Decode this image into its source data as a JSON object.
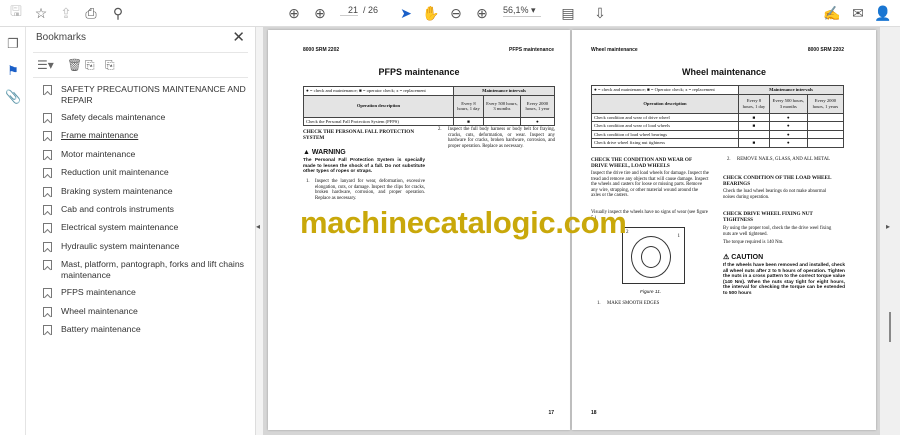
{
  "toolbar": {
    "page_current": "21",
    "page_total": "/ 26",
    "zoom": "56,1%",
    "zoom_caret": "▾"
  },
  "bookmarks": {
    "title": "Bookmarks",
    "close": "✕",
    "items": [
      "SAFETY PRECAUTIONS MAINTENANCE AND REPAIR",
      "Safety decals maintenance",
      "Frame maintenance",
      "Motor maintenance",
      "Reduction unit maintenance",
      "Braking system maintenance",
      "Cab and controls instruments",
      "Electrical system maintenance",
      "Hydraulic system maintenance",
      "Mast, platform, pantograph, forks and lift chains maintenance",
      "PFPS maintenance",
      "Wheel maintenance",
      "Battery maintenance"
    ]
  },
  "left_page": {
    "hdr_left": "8000 SRM 2202",
    "hdr_right": "PFPS maintenance",
    "title": "PFPS maintenance",
    "legend": "● = check and maintenance; ■ = operator check; x = replacement",
    "intervals": "Maintenance intervals",
    "op_desc": "Operation description",
    "cols": [
      "Every 8 hours, 1 day",
      "Every 500 hours, 3 months",
      "Every 2000 hours, 1 year"
    ],
    "rows": [
      {
        "desc": "Check the Personal Fall Protection System (PFPS)",
        "c1": "■",
        "c2": "",
        "c3": "●"
      }
    ],
    "section": "CHECK THE PERSONAL FALL PROTECTION SYSTEM",
    "warning": "WARNING",
    "warning_text": "The Personal Fall Protection System is specially made to lessen the shock of a fall. Do not substitute other types of ropes or straps.",
    "step1_num": "1.",
    "step1": "Inspect the lanyard for wear, deformation, excessive elongation, cuts, or damage. Inspect the clips for cracks, broken hardware, corrosion, and proper operation. Replace as necessary.",
    "step2_num": "2.",
    "step2": "Inspect the full body harness or body belt for fraying, cracks, cuts, deformation, or wear. Inspect any hardware for cracks, broken hardware, corrosion, and proper operation. Replace as necessary.",
    "page_num": "17"
  },
  "right_page": {
    "hdr_left": "Wheel maintenance",
    "hdr_right": "8000 SRM 2202",
    "title": "Wheel maintenance",
    "legend": "● = check and maintenance; ■ = Operator check; x = replacement",
    "intervals": "Maintenance intervals",
    "op_desc": "Operation description",
    "cols": [
      "Every 8 hours, 1 day",
      "Every 500 hours, 3 months",
      "Every 2000 hours, 1 years"
    ],
    "rows": [
      {
        "desc": "Check condition and wear of drive wheel",
        "c1": "■",
        "c2": "●",
        "c3": ""
      },
      {
        "desc": "Check condition and wear of load wheels",
        "c1": "■",
        "c2": "●",
        "c3": ""
      },
      {
        "desc": "Check condition of load wheel bearings",
        "c1": "",
        "c2": "●",
        "c3": ""
      },
      {
        "desc": "Check drive wheel fixing nut tightness",
        "c1": "■",
        "c2": "●",
        "c3": ""
      }
    ],
    "s1": "CHECK THE CONDITION AND WEAR OF DRIVE WHEEL, LOAD WHEELS",
    "p1": "Inspect the drive tire and load wheels for damage. Inspect the tread and remove any objects that will cause damage. Inspect the wheels and casters for loose or missing parts. Remove any wire, strapping, or other material wound around the axles or the casters.",
    "p2": "Visually inspect the wheels have no signs of wear (see figure 5.)",
    "figure": "Figure 11.",
    "callout1": "1",
    "callout2": "2",
    "step1_num": "1.",
    "step1": "MAKE SMOOTH EDGES",
    "step2_num": "2.",
    "step2": "REMOVE NAILS, GLASS, AND ALL METAL",
    "s2": "CHECK CONDITION OF THE LOAD WHEEL BEARINGS",
    "p3": "Check the load wheel bearings do not make abnormal noises during operation.",
    "s3": "CHECK DRIVE WHEEL FIXING NUT TIGHTNESS",
    "p4": "By using the proper tool, check the the drive weel fixing nuts are well tightened.",
    "p5": "The torque required is 140 Nm.",
    "caution": "CAUTION",
    "caution_text": "If the wheels have been removed and installed, check all wheel nuts after 2 to 5 hours of operation. Tighten the nuts in a cross pattern to the correct torque value (140 Nm). When the nuts stay tight for eight hours, the interval for checking the torque can be extended to 500 hours",
    "page_num": "18"
  },
  "watermark": "machinecatalogic.com"
}
